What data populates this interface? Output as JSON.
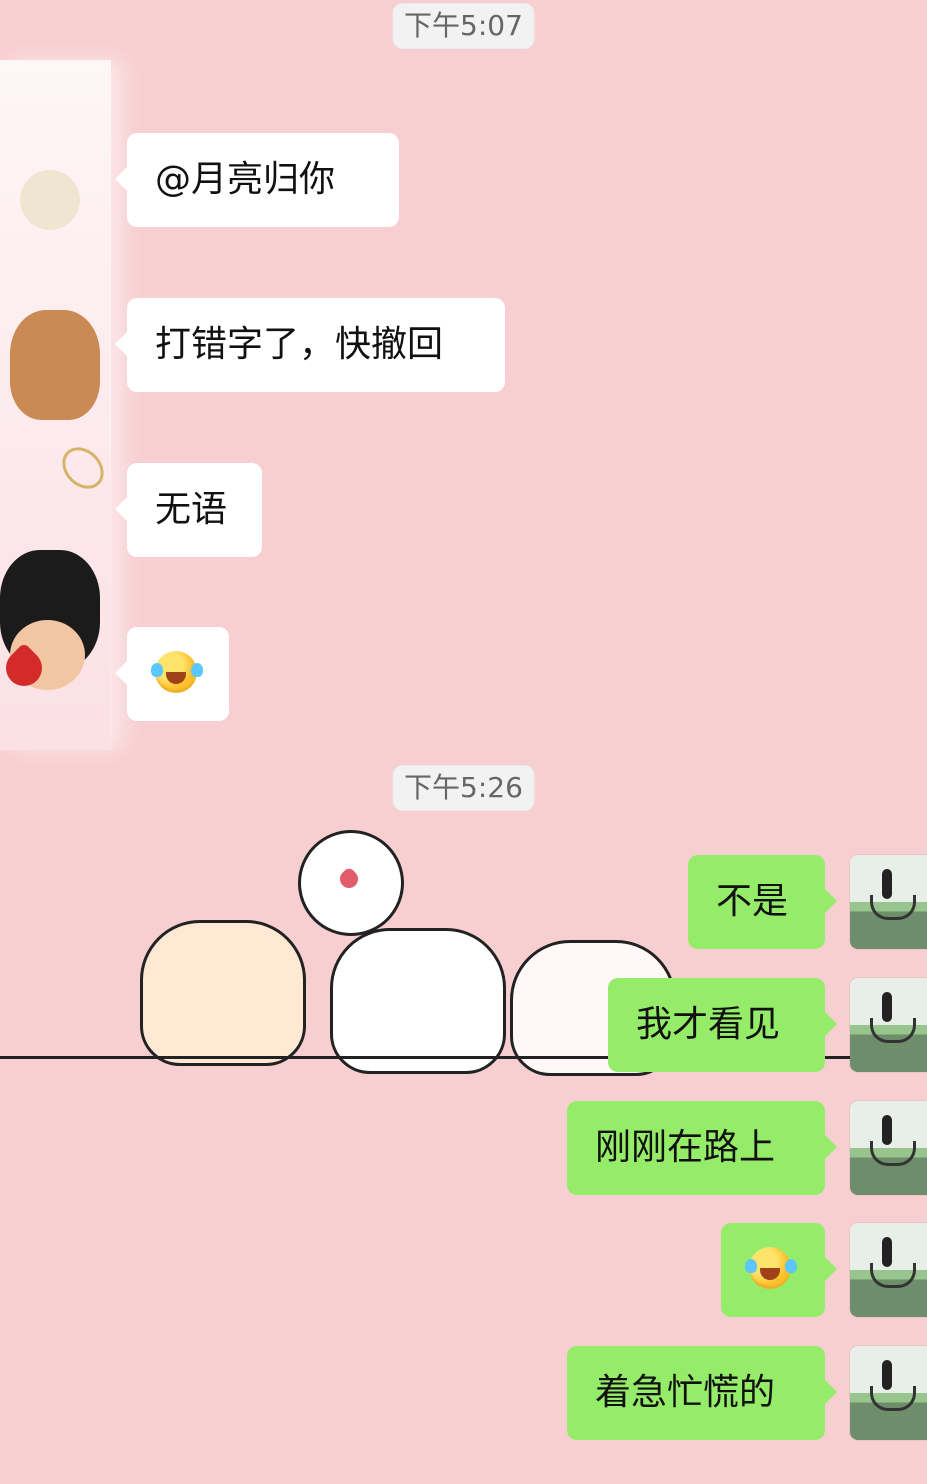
{
  "timestamps": {
    "t1": "下午5:07",
    "t2": "下午5:26"
  },
  "messages": {
    "left": [
      {
        "text": "@月亮归你"
      },
      {
        "text": "打错字了，快撤回"
      },
      {
        "text": "无语"
      },
      {
        "emoji": "crying-laughing"
      }
    ],
    "right": [
      {
        "text": "不是"
      },
      {
        "text": "我才看见"
      },
      {
        "text": "刚刚在路上"
      },
      {
        "emoji": "crying-laughing"
      },
      {
        "text": "着急忙慌的"
      }
    ]
  },
  "colors": {
    "background": "#f8cfd1",
    "left_bubble": "#ffffff",
    "right_bubble": "#95ec69",
    "timestamp_bg": "#f2f2f2"
  },
  "icons": {
    "left_avatar": "sticker-avatar",
    "right_avatar": "photo-avatar",
    "emoji": "crying-laughing-emoji"
  }
}
